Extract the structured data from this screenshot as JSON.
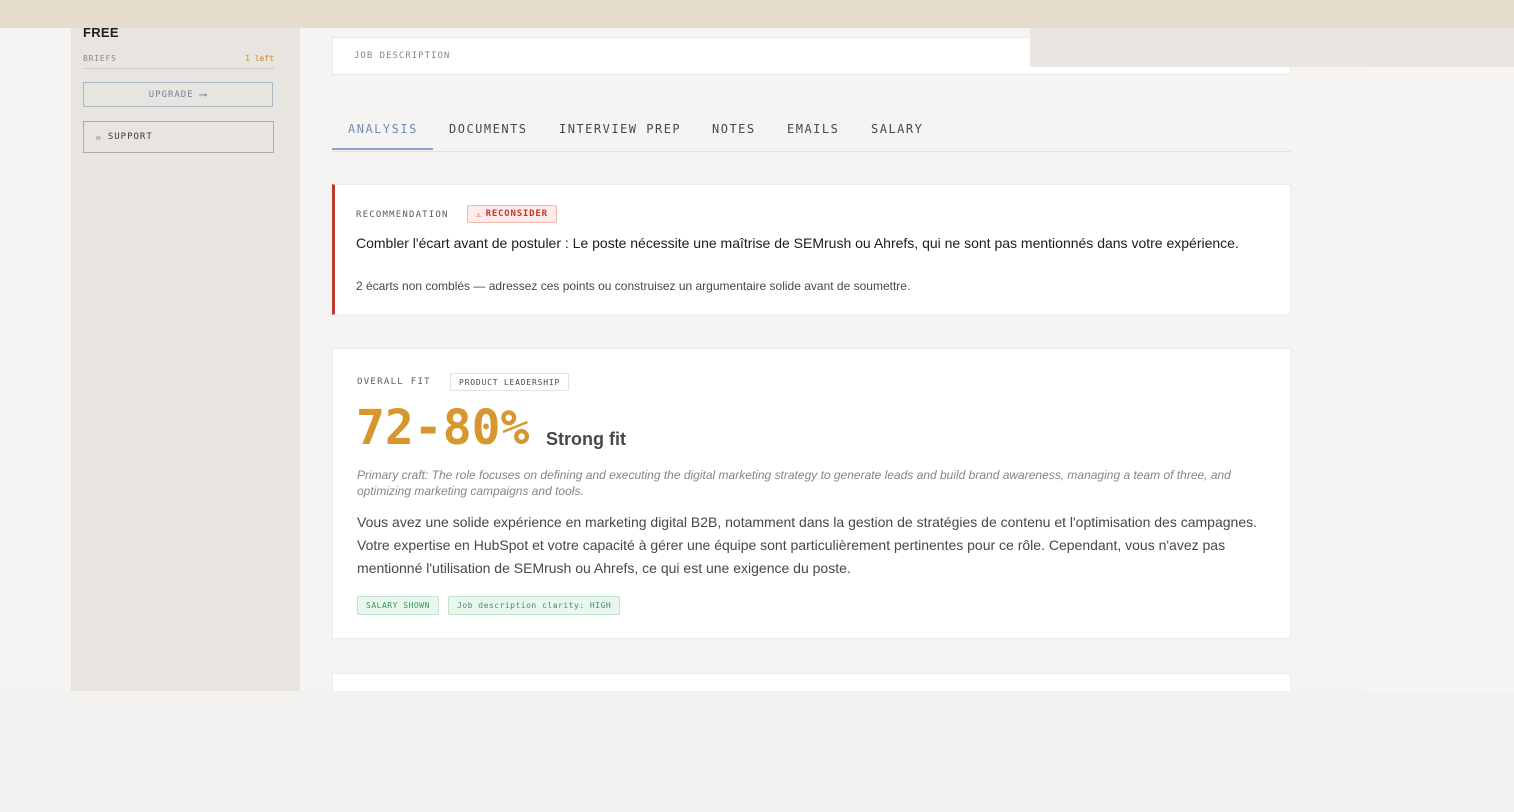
{
  "sidebar": {
    "plan": "FREE",
    "briefs_label": "BRIEFS",
    "briefs_count": "1 left",
    "upgrade_label": "UPGRADE",
    "upgrade_icon": "arrow-right-icon",
    "support_label": "SUPPORT",
    "support_icon": "mail-icon"
  },
  "job_description": {
    "label": "JOB DESCRIPTION"
  },
  "tabs": [
    {
      "label": "ANALYSIS",
      "active": true
    },
    {
      "label": "DOCUMENTS"
    },
    {
      "label": "INTERVIEW PREP"
    },
    {
      "label": "NOTES"
    },
    {
      "label": "EMAILS"
    },
    {
      "label": "SALARY"
    }
  ],
  "recommendation": {
    "label": "RECOMMENDATION",
    "badge": "RECONSIDER",
    "badge_icon": "warning-icon",
    "title": "Combler l'écart avant de postuler : Le poste nécessite une maîtrise de SEMrush ou Ahrefs, qui ne sont pas mentionnés dans votre expérience.",
    "subtitle": "2 écarts non comblés — adressez ces points ou construisez un argumentaire solide avant de soumettre.",
    "accent_color": "#c0392b"
  },
  "fit": {
    "label": "OVERALL FIT",
    "category": "PRODUCT LEADERSHIP",
    "score": "72-80%",
    "verdict": "Strong fit",
    "craft": "Primary craft: The role focuses on defining and executing the digital marketing strategy to generate leads and build brand awareness, managing a team of three, and optimizing marketing campaigns and tools.",
    "body": "Vous avez une solide expérience en marketing digital B2B, notamment dans la gestion de stratégies de contenu et l'optimisation des campagnes. Votre expertise en HubSpot et votre capacité à gérer une équipe sont particulièrement pertinentes pour ce rôle. Cependant, vous n'avez pas mentionné l'utilisation de SEMrush ou Ahrefs, ce qui est une exigence du poste.",
    "tags": [
      "SALARY SHOWN",
      "Job description clarity: HIGH"
    ],
    "score_color": "#d6972e"
  }
}
